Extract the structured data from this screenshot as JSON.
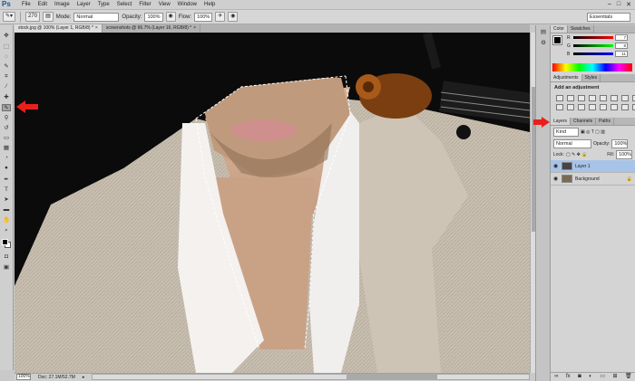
{
  "menu": {
    "logo": "Ps",
    "items": [
      "File",
      "Edit",
      "Image",
      "Layer",
      "Type",
      "Select",
      "Filter",
      "View",
      "Window",
      "Help"
    ]
  },
  "options": {
    "brush_size": "270",
    "mode_label": "Mode:",
    "mode_value": "Normal",
    "opacity_label": "Opacity:",
    "opacity_value": "100%",
    "flow_label": "Flow:",
    "flow_value": "100%",
    "workspace": "Essentials"
  },
  "tabs": [
    {
      "label": "stock.jpg @ 100% (Layer 1, RGB/8) *"
    },
    {
      "label": "screenshots @ 66.7% (Layer 16, RGB/8) *"
    }
  ],
  "status": {
    "zoom": "100%",
    "doc": "Doc: 27.1M/52.7M"
  },
  "color_panel": {
    "tabs": [
      "Color",
      "Swatches"
    ],
    "r": "7",
    "g": "8",
    "b": "11",
    "r_label": "R",
    "g_label": "G",
    "b_label": "B"
  },
  "adjust_panel": {
    "tabs": [
      "Adjustments",
      "Styles"
    ],
    "title": "Add an adjustment"
  },
  "layers_panel": {
    "tabs": [
      "Layers",
      "Channels",
      "Paths"
    ],
    "kind": "Kind",
    "blend_mode": "Normal",
    "opacity_label": "Opacity:",
    "opacity_value": "100%",
    "lock_label": "Lock:",
    "fill_label": "Fill:",
    "fill_value": "100%",
    "layers": [
      {
        "name": "Layer 1",
        "selected": true
      },
      {
        "name": "Background",
        "selected": false
      }
    ]
  },
  "colors": {
    "arrow": "#e8201c",
    "selection_bg": "#a8c3e8"
  }
}
